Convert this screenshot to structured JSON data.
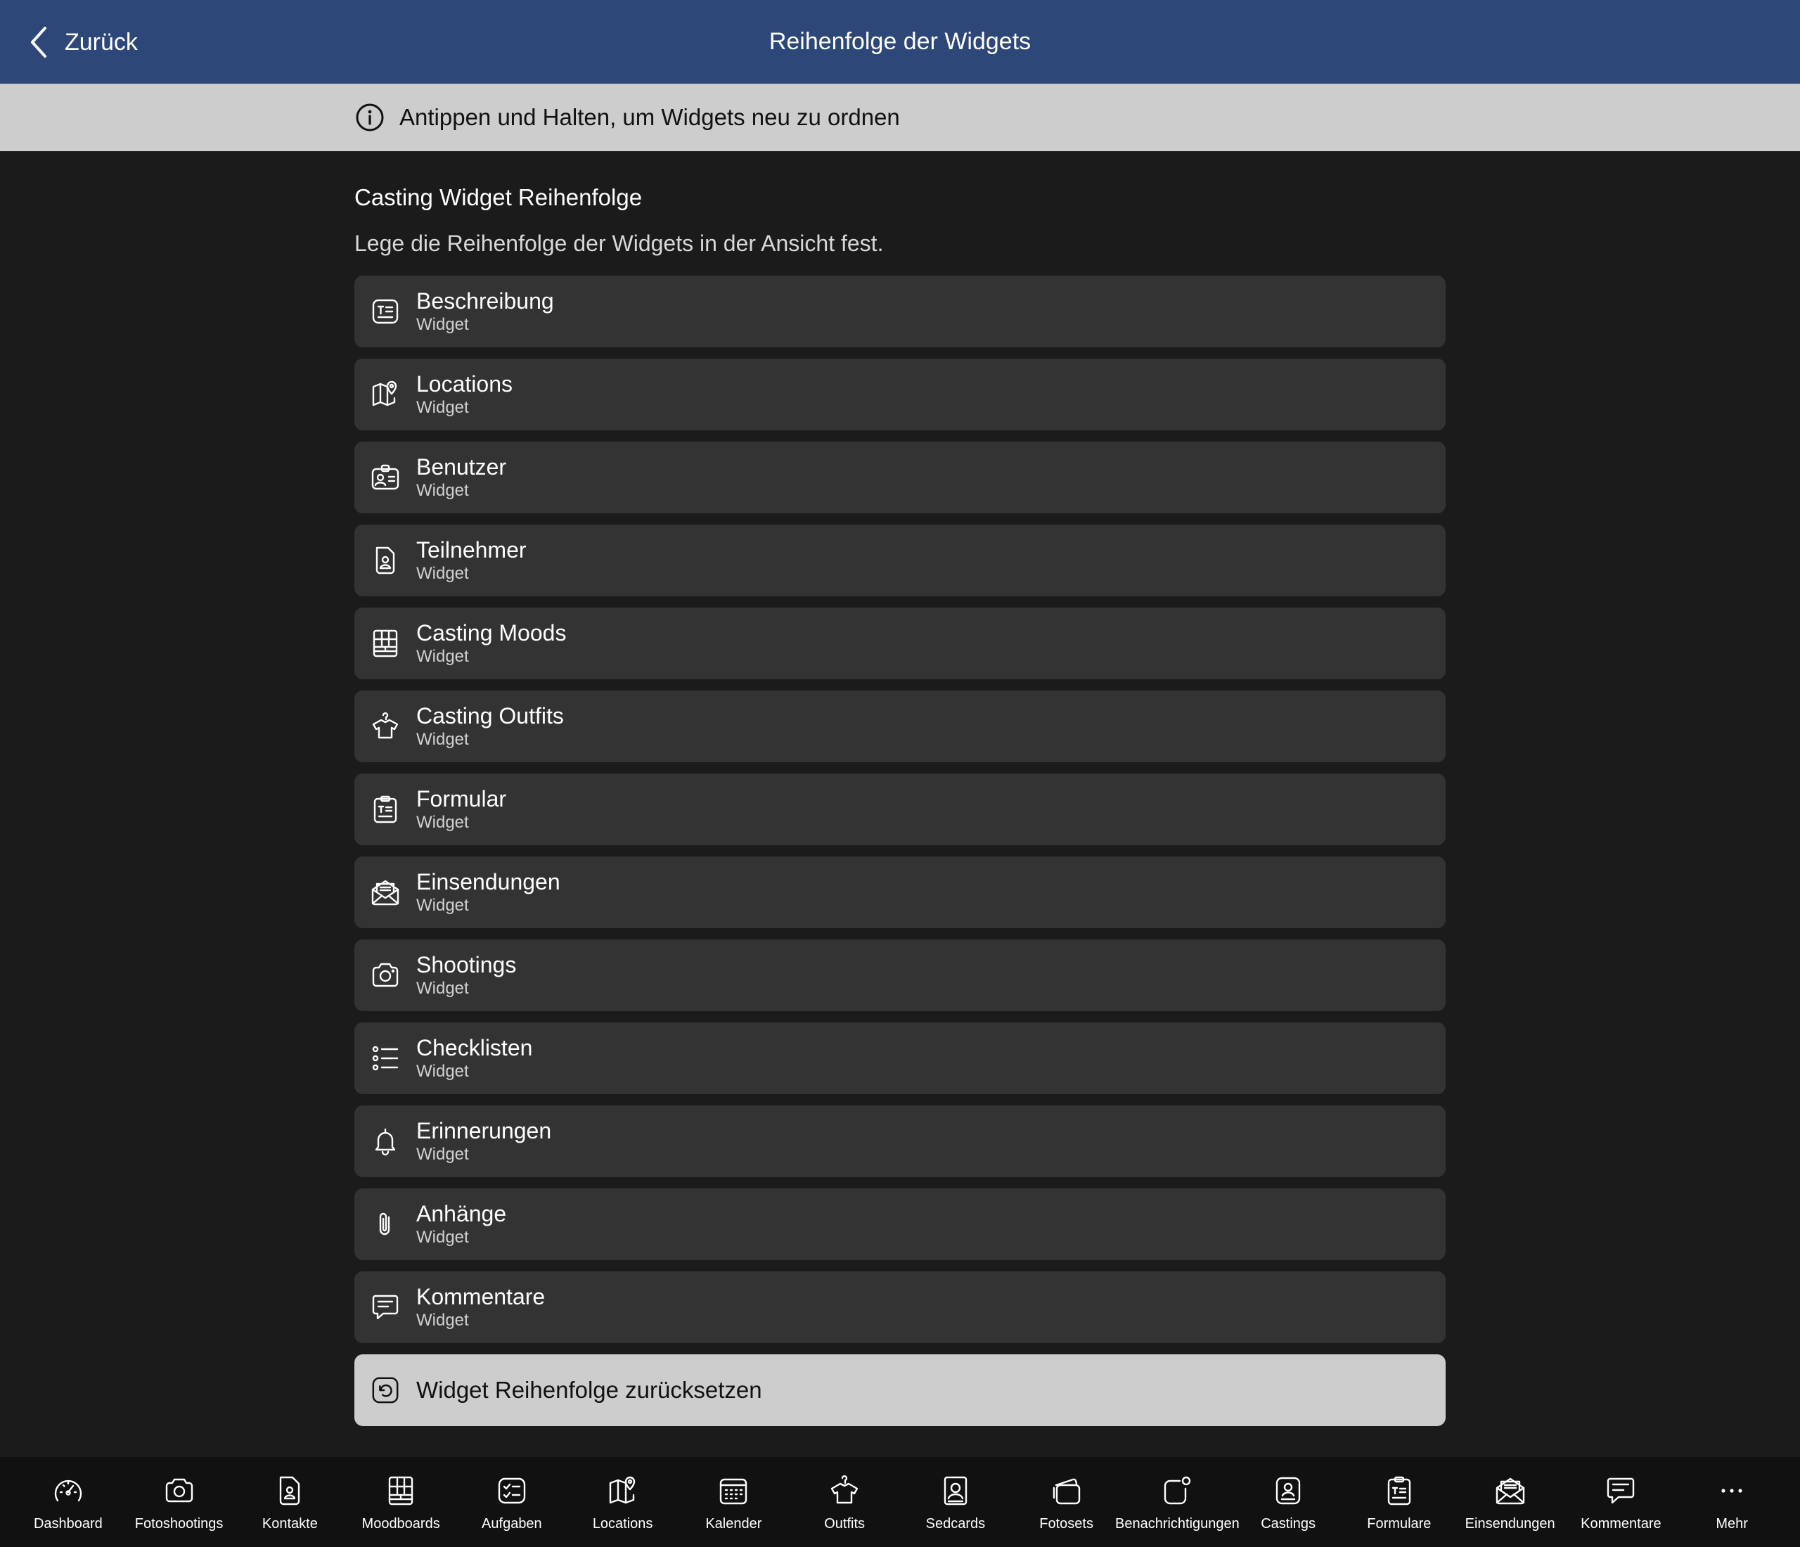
{
  "header": {
    "back_label": "Zurück",
    "title": "Reihenfolge der Widgets"
  },
  "info": {
    "text": "Antippen und Halten, um Widgets neu zu ordnen"
  },
  "section": {
    "title": "Casting Widget Reihenfolge",
    "description": "Lege die Reihenfolge der Widgets in der Ansicht fest."
  },
  "widgets": [
    {
      "name": "Beschreibung",
      "sub": "Widget",
      "icon": "text-card-icon"
    },
    {
      "name": "Locations",
      "sub": "Widget",
      "icon": "map-pin-icon"
    },
    {
      "name": "Benutzer",
      "sub": "Widget",
      "icon": "id-badge-icon"
    },
    {
      "name": "Teilnehmer",
      "sub": "Widget",
      "icon": "contact-file-icon"
    },
    {
      "name": "Casting Moods",
      "sub": "Widget",
      "icon": "moodboard-grid-icon"
    },
    {
      "name": "Casting Outfits",
      "sub": "Widget",
      "icon": "shirt-hanger-icon"
    },
    {
      "name": "Formular",
      "sub": "Widget",
      "icon": "clipboard-form-icon"
    },
    {
      "name": "Einsendungen",
      "sub": "Widget",
      "icon": "envelope-open-icon"
    },
    {
      "name": "Shootings",
      "sub": "Widget",
      "icon": "camera-icon"
    },
    {
      "name": "Checklisten",
      "sub": "Widget",
      "icon": "checklist-icon"
    },
    {
      "name": "Erinnerungen",
      "sub": "Widget",
      "icon": "bell-icon"
    },
    {
      "name": "Anhänge",
      "sub": "Widget",
      "icon": "paperclip-icon"
    },
    {
      "name": "Kommentare",
      "sub": "Widget",
      "icon": "comment-icon"
    }
  ],
  "reset": {
    "label": "Widget Reihenfolge zurücksetzen",
    "icon": "reset-arrow-icon"
  },
  "tabbar": [
    {
      "label": "Dashboard",
      "icon": "speedometer-icon"
    },
    {
      "label": "Fotoshootings",
      "icon": "camera-icon"
    },
    {
      "label": "Kontakte",
      "icon": "contact-file-icon"
    },
    {
      "label": "Moodboards",
      "icon": "moodboard-grid-icon"
    },
    {
      "label": "Aufgaben",
      "icon": "task-list-icon"
    },
    {
      "label": "Locations",
      "icon": "map-pin-icon"
    },
    {
      "label": "Kalender",
      "icon": "calendar-icon"
    },
    {
      "label": "Outfits",
      "icon": "shirt-hanger-icon"
    },
    {
      "label": "Sedcards",
      "icon": "portrait-card-icon"
    },
    {
      "label": "Fotosets",
      "icon": "photo-stack-icon"
    },
    {
      "label": "Benachrichtigungen",
      "icon": "notification-badge-icon"
    },
    {
      "label": "Castings",
      "icon": "casting-card-icon"
    },
    {
      "label": "Formulare",
      "icon": "clipboard-form-icon"
    },
    {
      "label": "Einsendungen",
      "icon": "envelope-open-icon"
    },
    {
      "label": "Kommentare",
      "icon": "comment-icon"
    },
    {
      "label": "Mehr",
      "icon": "more-dots-icon"
    }
  ],
  "colors": {
    "header_bg": "#2d4779",
    "info_bg": "#cdcdcd",
    "page_bg": "#1b1b1b",
    "row_bg": "#333333",
    "tabbar_bg": "#111111"
  }
}
